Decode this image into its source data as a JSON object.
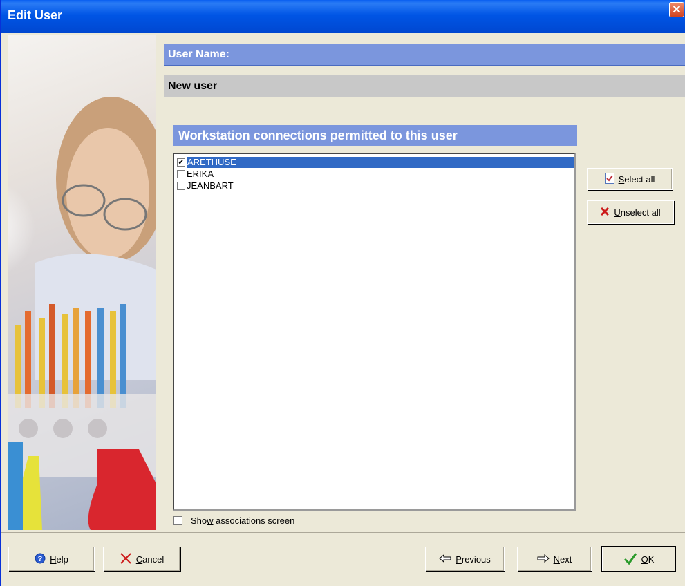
{
  "window": {
    "title": "Edit User",
    "close_glyph": "✕"
  },
  "header": {
    "user_name_label": "User Name:",
    "user_name_value": "New user"
  },
  "workstations": {
    "heading": "Workstation connections permitted to this user",
    "items": [
      {
        "label": "ARETHUSE",
        "checked": true,
        "selected": true
      },
      {
        "label": "ERIKA",
        "checked": false,
        "selected": false
      },
      {
        "label": "JEANBART",
        "checked": false,
        "selected": false
      }
    ]
  },
  "side_buttons": {
    "select_all": {
      "label_first": "S",
      "label_rest": "elect all",
      "icon": "checklist-icon"
    },
    "unselect_all": {
      "label_first": "U",
      "label_rest": "nselect all",
      "icon": "red-x-icon"
    }
  },
  "show_associations": {
    "label_pre": "Sho",
    "label_u": "w",
    "label_post": " associations screen",
    "checked": false
  },
  "footer": {
    "help": {
      "label_first": "H",
      "label_rest": "elp"
    },
    "cancel": {
      "label_first": "C",
      "label_rest": "ancel"
    },
    "previous": {
      "label_first": "P",
      "label_rest": "revious"
    },
    "next": {
      "label_first": "N",
      "label_rest": "ext"
    },
    "ok": {
      "label_first": "O",
      "label_rest": "K"
    }
  },
  "colors": {
    "accent_bar": "#7b96dd",
    "selection": "#316ac5",
    "title_blue": "#0055e5"
  }
}
